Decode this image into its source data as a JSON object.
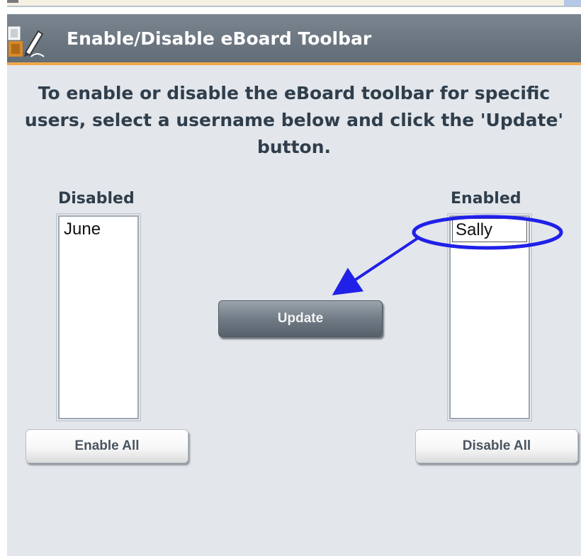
{
  "header": {
    "title": "Enable/Disable eBoard Toolbar",
    "icon": "toolbar-pen-icon"
  },
  "instructions": {
    "text": "To enable or disable the eBoard toolbar for specific users, select a username below and click the 'Update' button."
  },
  "disabled_list": {
    "label": "Disabled",
    "items": [
      "June"
    ]
  },
  "enabled_list": {
    "label": "Enabled",
    "items": [
      "Sally"
    ]
  },
  "buttons": {
    "update": "Update",
    "enable_all": "Enable All",
    "disable_all": "Disable All"
  },
  "colors": {
    "header_bg": "#6f7a84",
    "header_accent": "#f0a84a",
    "panel_bg": "#e3e6ea",
    "text_dark": "#2f3e4c",
    "annotation": "#2020e8"
  }
}
